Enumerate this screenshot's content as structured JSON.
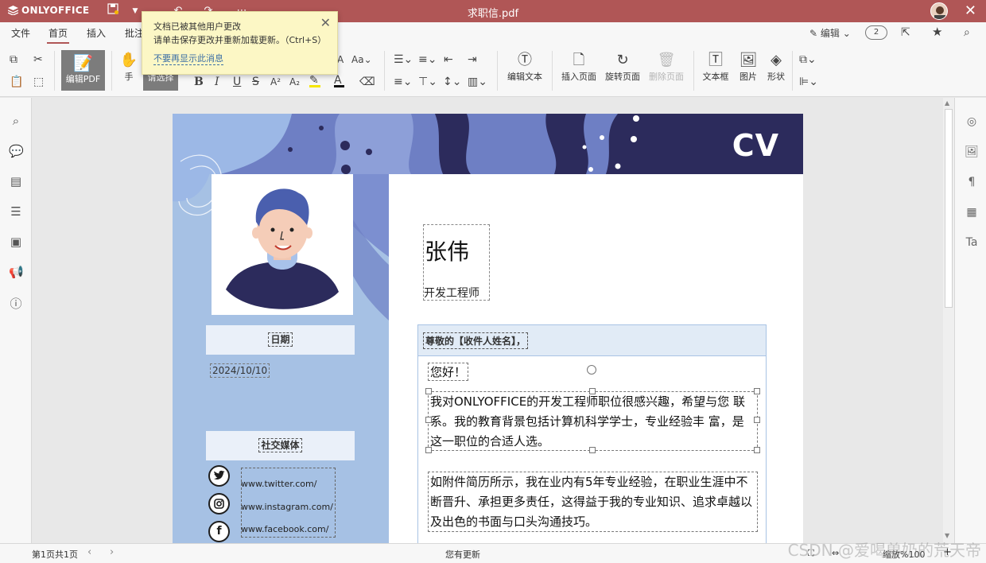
{
  "app": {
    "brand": "ONLYOFFICE",
    "doc_title": "求职信.pdf"
  },
  "menu": {
    "tabs": [
      "文件",
      "首页",
      "插入",
      "批注"
    ],
    "active_tab": "首页",
    "edit_mode": "编辑",
    "user_count": "2"
  },
  "toolbar": {
    "edit_pdf": "编辑PDF",
    "hand": "手",
    "select": "请选择",
    "edit_text": "编辑文本",
    "insert_page": "插入页面",
    "rotate_page": "旋转页面",
    "delete_page": "删除页面",
    "text_box": "文本框",
    "image": "图片",
    "shape": "形状"
  },
  "toast": {
    "line1": "文档已被其他用户更改",
    "line2": "请单击保存更改并重新加载更新。（Ctrl+S）",
    "dont_show": "不要再显示此消息"
  },
  "document": {
    "cv_label": "CV",
    "name": "张伟",
    "job_title": "开发工程师",
    "date_label": "日期",
    "date_value": "2024/10/10",
    "social_label": "社交媒体",
    "social_links": [
      "www.twitter.com/",
      "www.instagram.com/",
      "www.facebook.com/"
    ],
    "salutation": "尊敬的【收件人姓名】，",
    "greeting": "您好！",
    "paragraph1": "我对ONLYOFFICE的开发工程师职位很感兴趣，希望与您 联系。我的教育背景包括计算机科学学士，专业经验丰 富，是这一职位的合适人选。",
    "paragraph2": "如附件简历所示，我在业内有5年专业经验，在职业生涯中不断晋升、承担更多责任，这得益于我的专业知识、追求卓越以及出色的书面与口头沟通技巧。"
  },
  "status": {
    "page_info": "第1页共1页",
    "update_msg": "您有更新",
    "zoom": "缩放%100"
  },
  "watermark": "CSDN @爱喝兽奶的荒天帝",
  "colors": {
    "titlebar": "#b05656",
    "sidebar_blue": "#a6c1e4",
    "banner_dark": "#2c2b5c",
    "banner_mid": "#6e7fc4",
    "toast_bg": "#fcf7c5"
  }
}
